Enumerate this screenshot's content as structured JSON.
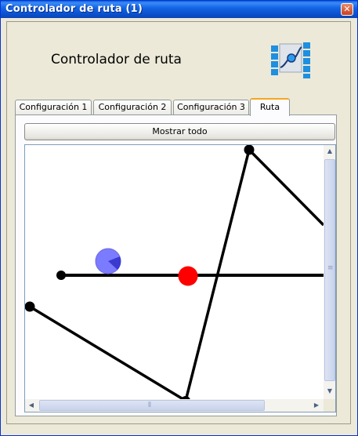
{
  "window": {
    "title": "Controlador de ruta (1)",
    "close_glyph": "✕"
  },
  "header": {
    "title": "Controlador de ruta",
    "icon": "route-controller-icon"
  },
  "tabs": [
    {
      "label": "Configuración 1",
      "active": false
    },
    {
      "label": "Configuración 2",
      "active": false
    },
    {
      "label": "Configuración 3",
      "active": false
    },
    {
      "label": "Ruta",
      "active": true
    }
  ],
  "route_panel": {
    "show_all_label": "Mostrar todo",
    "scroll_arrow_up": "▲",
    "scroll_arrow_down": "▼",
    "scroll_arrow_left": "◀",
    "scroll_arrow_right": "▶",
    "scroll_grip_v": "≡",
    "scroll_grip_h": "⦀"
  },
  "colors": {
    "path": "#000000",
    "waypoint": "#000000",
    "current_position": "#ff0000",
    "vehicle": "#7b7bff",
    "vehicle_heading": "#3a3ad0",
    "tab_highlight": "#f5a623"
  }
}
